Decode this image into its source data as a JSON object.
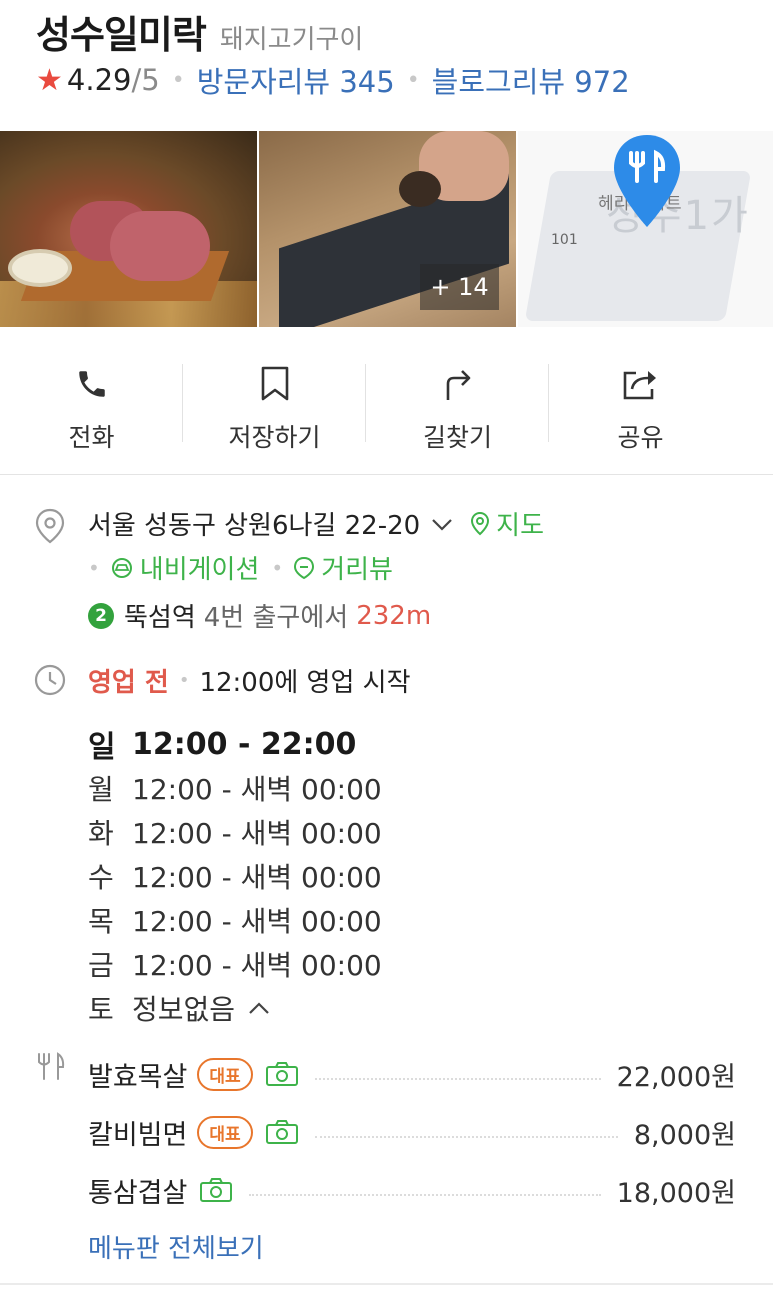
{
  "header": {
    "title": "성수일미락",
    "category": "돼지고기구이",
    "rating": "4.29",
    "rating_max": "/5",
    "visitor_reviews": "방문자리뷰 345",
    "blog_reviews": "블로그리뷰 972"
  },
  "photos": {
    "more_label": "+ 14",
    "map_label_101": "101",
    "map_label_apt": "헤리 아파트",
    "map_label_big": "성수1가"
  },
  "actions": [
    {
      "label": "전화",
      "icon": "phone-icon"
    },
    {
      "label": "저장하기",
      "icon": "bookmark-icon"
    },
    {
      "label": "길찾기",
      "icon": "directions-icon"
    },
    {
      "label": "공유",
      "icon": "share-icon"
    }
  ],
  "address": {
    "text": "서울 성동구 상원6나길 22-20",
    "map_link": "지도",
    "navigation": "내비게이션",
    "streetview": "거리뷰",
    "subway_line": "2",
    "subway_station": "뚝섬역",
    "subway_exit": "4번 출구에서",
    "subway_distance": "232m"
  },
  "hours": {
    "status": "영업 전",
    "status_detail": "12:00에 영업 시작",
    "rows": [
      {
        "day": "일",
        "time": "12:00 - 22:00"
      },
      {
        "day": "월",
        "time": "12:00 - 새벽 00:00"
      },
      {
        "day": "화",
        "time": "12:00 - 새벽 00:00"
      },
      {
        "day": "수",
        "time": "12:00 - 새벽 00:00"
      },
      {
        "day": "목",
        "time": "12:00 - 새벽 00:00"
      },
      {
        "day": "금",
        "time": "12:00 - 새벽 00:00"
      },
      {
        "day": "토",
        "time": "정보없음"
      }
    ]
  },
  "menu": {
    "items": [
      {
        "name": "발효목살",
        "badge": "대표",
        "price": "22,000원"
      },
      {
        "name": "칼비빔면",
        "badge": "대표",
        "price": "8,000원"
      },
      {
        "name": "통삼겹살",
        "badge": "",
        "price": "18,000원"
      }
    ],
    "view_all": "메뉴판 전체보기"
  },
  "colors": {
    "accent_blue": "#3a70b8",
    "accent_green": "#3eb34a",
    "status_red": "#e05a4c",
    "badge_orange": "#e8762c",
    "star_red": "#e94a3f"
  }
}
